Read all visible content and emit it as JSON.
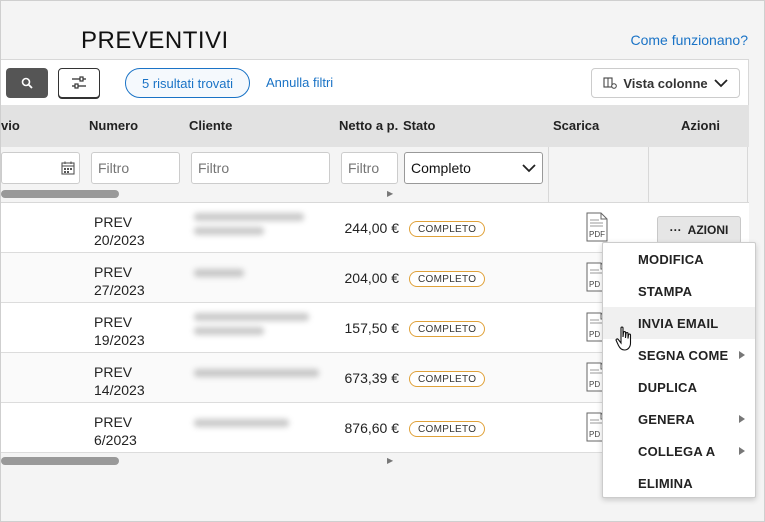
{
  "page": {
    "title": "PREVENTIVI",
    "help_link": "Come funzionano?"
  },
  "toolbar": {
    "search_icon": "search-icon",
    "filter_icon": "sliders-icon",
    "results_label": "5 risultati trovati",
    "clear_filters": "Annulla filtri",
    "columns_view": "Vista colonne"
  },
  "table": {
    "headers": [
      "vio",
      "Numero",
      "Cliente",
      "Netto a p.",
      "Stato",
      "Scarica",
      "Azioni"
    ],
    "filters": {
      "numero_placeholder": "Filtro",
      "cliente_placeholder": "Filtro",
      "netto_placeholder": "Filtro",
      "stato_selected": "Completo"
    },
    "rows": [
      {
        "prev": "PREV",
        "numero": "20/2023",
        "netto": "244,00 €",
        "stato": "COMPLETO",
        "pdf": "PDF"
      },
      {
        "prev": "PREV",
        "numero": "27/2023",
        "netto": "204,00 €",
        "stato": "COMPLETO",
        "pdf": "PD"
      },
      {
        "prev": "PREV",
        "numero": "19/2023",
        "netto": "157,50 €",
        "stato": "COMPLETO",
        "pdf": "PD"
      },
      {
        "prev": "PREV",
        "numero": "14/2023",
        "netto": "673,39 €",
        "stato": "COMPLETO",
        "pdf": "PD"
      },
      {
        "prev": "PREV",
        "numero": "6/2023",
        "netto": "876,60 €",
        "stato": "COMPLETO",
        "pdf": "PD"
      }
    ],
    "azioni_label": "AZIONI"
  },
  "menu": {
    "items": [
      {
        "label": "MODIFICA"
      },
      {
        "label": "STAMPA"
      },
      {
        "label": "INVIA EMAIL"
      },
      {
        "label": "SEGNA COME"
      },
      {
        "label": "DUPLICA"
      },
      {
        "label": "GENERA"
      },
      {
        "label": "COLLEGA A"
      },
      {
        "label": "ELIMINA"
      }
    ]
  },
  "colors": {
    "accent": "#1a73c6",
    "badge_border": "#e0a23a",
    "header_bg": "#e2e2e2"
  }
}
